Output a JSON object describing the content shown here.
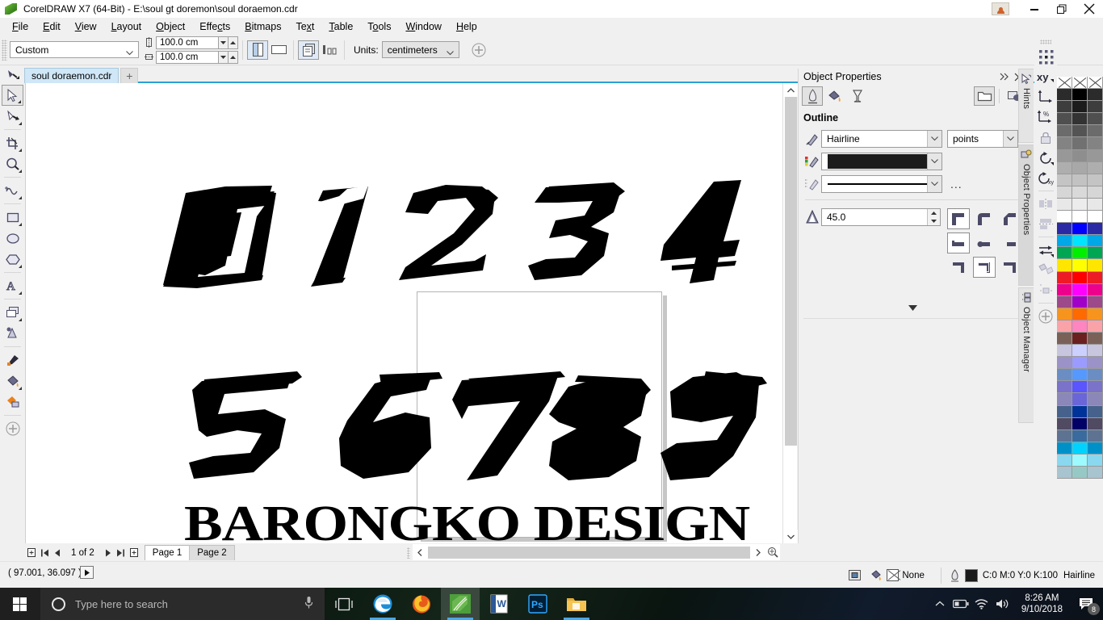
{
  "window": {
    "title": "CorelDRAW X7 (64-Bit) - E:\\soul gt doremon\\soul doraemon.cdr",
    "app_icon": "coreldraw-balloon-icon",
    "user_account_icon": "user-account-icon",
    "minimize_icon": "minimize-icon",
    "restore_icon": "restore-icon",
    "close_icon": "close-icon"
  },
  "menubar": {
    "items": [
      {
        "label": "File",
        "mnemonic": "F"
      },
      {
        "label": "Edit",
        "mnemonic": "E"
      },
      {
        "label": "View",
        "mnemonic": "V"
      },
      {
        "label": "Layout",
        "mnemonic": "L"
      },
      {
        "label": "Object",
        "mnemonic": "O"
      },
      {
        "label": "Effects",
        "mnemonic": "c"
      },
      {
        "label": "Bitmaps",
        "mnemonic": "B"
      },
      {
        "label": "Text",
        "mnemonic": "x"
      },
      {
        "label": "Table",
        "mnemonic": "T"
      },
      {
        "label": "Tools",
        "mnemonic": "o"
      },
      {
        "label": "Window",
        "mnemonic": "W"
      },
      {
        "label": "Help",
        "mnemonic": "H"
      }
    ]
  },
  "propertybar": {
    "page_preset": "Custom",
    "page_width": "100.0 cm",
    "page_height": "100.0 cm",
    "width_icon": "page-width-icon",
    "height_icon": "page-height-icon",
    "portrait_icon": "portrait-orientation-icon",
    "landscape_icon": "landscape-orientation-icon",
    "all_pages_icon": "all-pages-icon",
    "current_page_icon": "current-page-only-icon",
    "units_label": "Units:",
    "units_value": "centimeters",
    "add_icon": "add-tool-icon"
  },
  "documenttabs": {
    "tool_icon": "shape-tool-icon",
    "tabs": [
      {
        "label": "soul doraemon.cdr",
        "active": true
      }
    ],
    "add_label": "+"
  },
  "toolbox": {
    "tools": [
      {
        "name": "pick-tool",
        "icon": "arrow-cursor-icon",
        "active": true,
        "flyout": true
      },
      {
        "name": "shape-tool",
        "icon": "node-edit-icon",
        "active": false,
        "flyout": true
      },
      {
        "name": "crop-tool",
        "icon": "crop-icon",
        "active": false,
        "flyout": true
      },
      {
        "name": "zoom-tool",
        "icon": "magnifier-icon",
        "active": false,
        "flyout": true
      },
      {
        "name": "freehand-tool",
        "icon": "freehand-curve-icon",
        "active": false,
        "flyout": true
      },
      {
        "name": "rectangle-tool",
        "icon": "rectangle-icon",
        "active": false,
        "flyout": true
      },
      {
        "name": "ellipse-tool",
        "icon": "ellipse-icon",
        "active": false,
        "flyout": false
      },
      {
        "name": "polygon-tool",
        "icon": "polygon-icon",
        "active": false,
        "flyout": true
      },
      {
        "name": "text-tool",
        "icon": "text-a-icon",
        "active": false,
        "flyout": true
      },
      {
        "name": "parallel-dimension-tool",
        "icon": "dimension-icon",
        "active": false,
        "flyout": true
      },
      {
        "name": "shadow-tool",
        "icon": "drop-shadow-icon",
        "active": false,
        "flyout": true
      },
      {
        "name": "color-eyedropper-tool",
        "icon": "eyedropper-icon",
        "active": false,
        "flyout": true
      },
      {
        "name": "fill-tool",
        "icon": "fill-bucket-icon",
        "active": false,
        "flyout": true
      },
      {
        "name": "interactive-fill-tool",
        "icon": "interactive-fill-icon",
        "active": false,
        "flyout": true
      },
      {
        "name": "quick-customize",
        "icon": "plus-circle-icon",
        "active": false,
        "flyout": false
      }
    ]
  },
  "canvas": {
    "artwork_numerals_row1": "0 1 2 3 4",
    "artwork_numerals_row2": "5 6 7 8 9",
    "artwork_text": "BARONGKO DESIGN",
    "artwork_description": "racing-style-sliced-numeral-font-specimen"
  },
  "pagenav": {
    "add_page_start_icon": "add-page-before-icon",
    "first_icon": "first-page-icon",
    "prev_icon": "previous-page-icon",
    "counter": "1 of 2",
    "next_icon": "next-page-icon",
    "last_icon": "last-page-icon",
    "add_page_end_icon": "add-page-after-icon",
    "pages": [
      {
        "label": "Page 1",
        "active": true
      },
      {
        "label": "Page 2",
        "active": false
      }
    ]
  },
  "scrollbars": {
    "h_left_icon": "scroll-left-icon",
    "h_right_icon": "scroll-right-icon",
    "zoom_icon": "zoom-to-fit-icon",
    "v_up_icon": "scroll-up-icon",
    "v_down_icon": "scroll-down-icon"
  },
  "statusbar": {
    "coordinates": "( 97.001, 36.097 )",
    "coord_play_icon": "playback-arrow-icon",
    "screen_icon": "screen-preview-icon",
    "fill_icon": "fill-bucket-icon",
    "fill_value": "None",
    "outline_icon": "outline-pen-icon",
    "outline_color": "C:0 M:0 Y:0 K:100",
    "outline_width": "Hairline",
    "outline_swatch_hex": "#1a1a1a"
  },
  "docker": {
    "title": "Object Properties",
    "collapse_icon": "collapse-docker-icon",
    "close_icon": "close-icon",
    "tabs": [
      {
        "name": "outline-tab",
        "icon": "outline-pen-icon",
        "selected": true
      },
      {
        "name": "fill-tab",
        "icon": "fill-bucket-icon",
        "selected": false
      },
      {
        "name": "transparency-tab",
        "icon": "transparency-glass-icon",
        "selected": false
      }
    ],
    "right_tabs": [
      {
        "name": "object-folder-tab",
        "icon": "folder-icon",
        "selected": true
      },
      {
        "name": "object-summary-tab",
        "icon": "object-shape-icon",
        "selected": false
      }
    ],
    "section_title": "Outline",
    "width_icon": "outline-width-icon",
    "width_value": "Hairline",
    "units_value": "points",
    "color_icon": "outline-color-icon",
    "color_hex": "#1c1c1c",
    "style_icon": "line-style-icon",
    "style_more": "...",
    "miter_icon": "miter-limit-icon",
    "miter_value": "45.0",
    "corner_buttons": [
      {
        "name": "corner-miter-button",
        "selected": true
      },
      {
        "name": "corner-round-button",
        "selected": false
      },
      {
        "name": "corner-bevel-button",
        "selected": false
      }
    ],
    "cap_buttons": [
      {
        "name": "cap-square-button",
        "selected": true
      },
      {
        "name": "cap-round-button",
        "selected": false
      },
      {
        "name": "cap-extended-square-button",
        "selected": false
      }
    ],
    "position_buttons": [
      {
        "name": "outline-position-outside-button",
        "selected": false
      },
      {
        "name": "outline-position-centered-button",
        "selected": true
      },
      {
        "name": "outline-position-inside-button",
        "selected": false
      }
    ],
    "expand_icon": "expand-more-icon"
  },
  "sidetabs": [
    {
      "label": "Hints",
      "icon": "hints-cursor-icon",
      "active": false
    },
    {
      "label": "Object Properties",
      "icon": "object-properties-icon",
      "active": true
    },
    {
      "label": "Object Manager",
      "icon": "object-manager-icon",
      "active": false
    }
  ],
  "righttoolbar": {
    "items": [
      {
        "name": "select-all-objects-tool",
        "icon": "selection-handles-icon",
        "flyout": false
      },
      {
        "name": "position-transform-tool",
        "icon": "xy-position-icon",
        "flyout": true
      },
      {
        "name": "size-transform-tool",
        "icon": "size-dimension-icon",
        "flyout": true
      },
      {
        "name": "scale-transform-tool",
        "icon": "scale-percent-icon",
        "flyout": true
      },
      {
        "name": "lock-ratio-tool",
        "icon": "lock-icon",
        "flyout": false
      },
      {
        "name": "rotate-tool",
        "icon": "rotate-icon",
        "flyout": true
      },
      {
        "name": "rotate-center-tool",
        "icon": "rotate-center-icon",
        "flyout": true
      },
      {
        "name": "align-horizontal-tool",
        "icon": "align-horizontal-icon",
        "flyout": false
      },
      {
        "name": "align-vertical-tool",
        "icon": "align-vertical-icon",
        "flyout": false
      },
      {
        "name": "mirror-tool",
        "icon": "mirror-flip-icon",
        "flyout": true
      },
      {
        "name": "duplicate-tool",
        "icon": "duplicate-icon",
        "flyout": false
      },
      {
        "name": "distribute-tool",
        "icon": "distribute-icon",
        "flyout": false
      },
      {
        "name": "quick-customize-right",
        "icon": "plus-circle-icon",
        "flyout": false
      }
    ]
  },
  "palette": {
    "columns": 3,
    "swatches": [
      [
        "none",
        "#2b2b2b",
        "#3d3d3d",
        "#4f4f4f",
        "#6b6b6b",
        "#838383",
        "#989898",
        "#aeaeae",
        "#c4c4c4",
        "#d6d6d6",
        "#e8e8e8",
        "#ffffff",
        "#2a2aa5",
        "#00a8e8",
        "#00a651",
        "#ffe600",
        "#ed1c24",
        "#ec008c",
        "#9c4a8a",
        "#f7941e",
        "#f9a3a8",
        "#7a6158",
        "#c8c6de",
        "#9b93c7",
        "#6a8ec4",
        "#7b72c9",
        "#8b87b8",
        "#46628c",
        "#504a63",
        "#5d7391",
        "#0090c8",
        "#89d8ef",
        "#a8c4cf"
      ],
      [
        "none",
        "#000000",
        "#1c1c1c",
        "#333333",
        "#545454",
        "#717171",
        "#8e8e8e",
        "#a8a8a8",
        "#c2c2c2",
        "#d9d9d9",
        "#ececec",
        "#ffffff",
        "#0000ff",
        "#00e5ff",
        "#00ee00",
        "#ffff00",
        "#ff0000",
        "#ff00ff",
        "#a100c8",
        "#ff6a00",
        "#ff85c0",
        "#6b2020",
        "#ccd0ff",
        "#9b9bff",
        "#5599ff",
        "#5a55ff",
        "#6a66d8",
        "#003399",
        "#000066",
        "#3a6b9e",
        "#00d2ff",
        "#9dfaff",
        "#96c9c6"
      ],
      [
        "none",
        "#2b2b2b",
        "#3d3d3d",
        "#4f4f4f",
        "#6b6b6b",
        "#838383",
        "#989898",
        "#aeaeae",
        "#c4c4c4",
        "#d6d6d6",
        "#e8e8e8",
        "#ffffff",
        "#2a2aa5",
        "#00a8e8",
        "#00a651",
        "#ffe600",
        "#ed1c24",
        "#ec008c",
        "#9c4a8a",
        "#f7941e",
        "#f9a3a8",
        "#7a6158",
        "#c8c6de",
        "#9b93c7",
        "#6a8ec4",
        "#7b72c9",
        "#8b87b8",
        "#46628c",
        "#504a63",
        "#5d7391",
        "#0090c8",
        "#89d8ef",
        "#a8c4cf"
      ]
    ],
    "scroll_down_icon": "palette-scroll-down-icon"
  },
  "taskbar": {
    "start_icon": "windows-start-icon",
    "search_placeholder": "Type here to search",
    "cortana_icon": "cortana-circle-icon",
    "mic_icon": "microphone-icon",
    "apps": [
      {
        "name": "task-view",
        "icon": "task-view-icon",
        "running": false,
        "active": false
      },
      {
        "name": "microsoft-edge",
        "icon": "edge-e-icon",
        "running": true,
        "active": false
      },
      {
        "name": "mozilla-firefox",
        "icon": "firefox-icon",
        "running": false,
        "active": false
      },
      {
        "name": "coreldraw",
        "icon": "coreldraw-balloon-icon",
        "running": true,
        "active": true
      },
      {
        "name": "microsoft-word",
        "icon": "word-w-icon",
        "running": false,
        "active": false
      },
      {
        "name": "adobe-photoshop",
        "icon": "photoshop-ps-icon",
        "running": false,
        "active": false
      },
      {
        "name": "file-explorer",
        "icon": "folder-icon",
        "running": true,
        "active": false
      }
    ],
    "tray": {
      "chevron_icon": "show-hidden-icons-icon",
      "battery_icon": "battery-icon",
      "wifi_icon": "wifi-icon",
      "volume_icon": "volume-icon",
      "time": "8:26 AM",
      "date": "9/10/2018",
      "notification_icon": "action-center-icon",
      "notification_count": "8"
    }
  }
}
